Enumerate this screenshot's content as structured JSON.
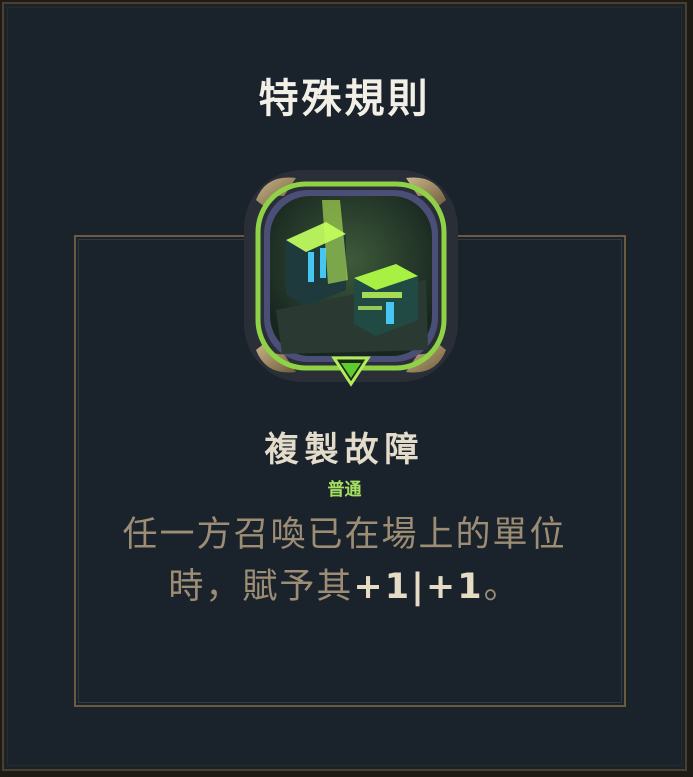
{
  "title": "特殊規則",
  "rule": {
    "name": "複製故障",
    "rarity": "普通",
    "description": "任一方召喚已在場上的單位時，賦予其",
    "stat": "+1|+1",
    "description_end": "。"
  },
  "icons": {
    "emblem": "glitch-duplicate-emblem",
    "indicator": "green-triangle-indicator"
  },
  "colors": {
    "background": "#1a232c",
    "gold_border": "#6b5a3e",
    "rarity_green": "#a6e062",
    "text_tan": "#9c8d74"
  }
}
